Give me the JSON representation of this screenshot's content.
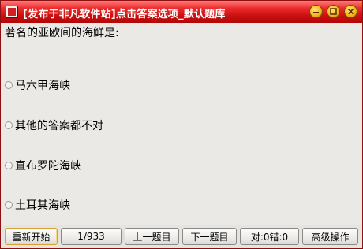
{
  "window": {
    "title": "[发布于非凡软件站]点击答案选项_默认题库"
  },
  "quiz": {
    "question": "著名的亚欧间的海鲜是:",
    "options": [
      "马六甲海峡",
      "其他的答案都不对",
      "直布罗陀海峡",
      "土耳其海峡"
    ]
  },
  "toolbar": {
    "restart_label": "重新开始",
    "progress_label": "1/933",
    "prev_label": "上一题目",
    "next_label": "下一题目",
    "score_label": "对:0错:0",
    "advanced_label": "高级操作"
  }
}
